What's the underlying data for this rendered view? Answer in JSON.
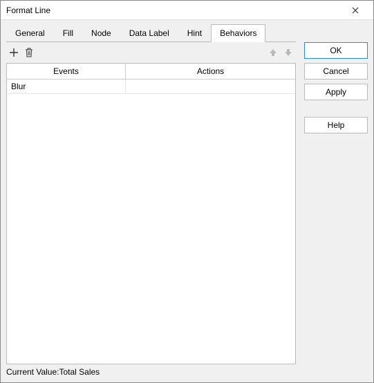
{
  "window": {
    "title": "Format Line"
  },
  "tabs": [
    {
      "label": "General",
      "active": false
    },
    {
      "label": "Fill",
      "active": false
    },
    {
      "label": "Node",
      "active": false
    },
    {
      "label": "Data Label",
      "active": false
    },
    {
      "label": "Hint",
      "active": false
    },
    {
      "label": "Behaviors",
      "active": true
    }
  ],
  "table": {
    "headers": {
      "events": "Events",
      "actions": "Actions"
    },
    "rows": [
      {
        "event": "Blur",
        "action": ""
      }
    ]
  },
  "status": {
    "label": "Current Value:",
    "value": "Total Sales"
  },
  "buttons": {
    "ok": "OK",
    "cancel": "Cancel",
    "apply": "Apply",
    "help": "Help"
  }
}
